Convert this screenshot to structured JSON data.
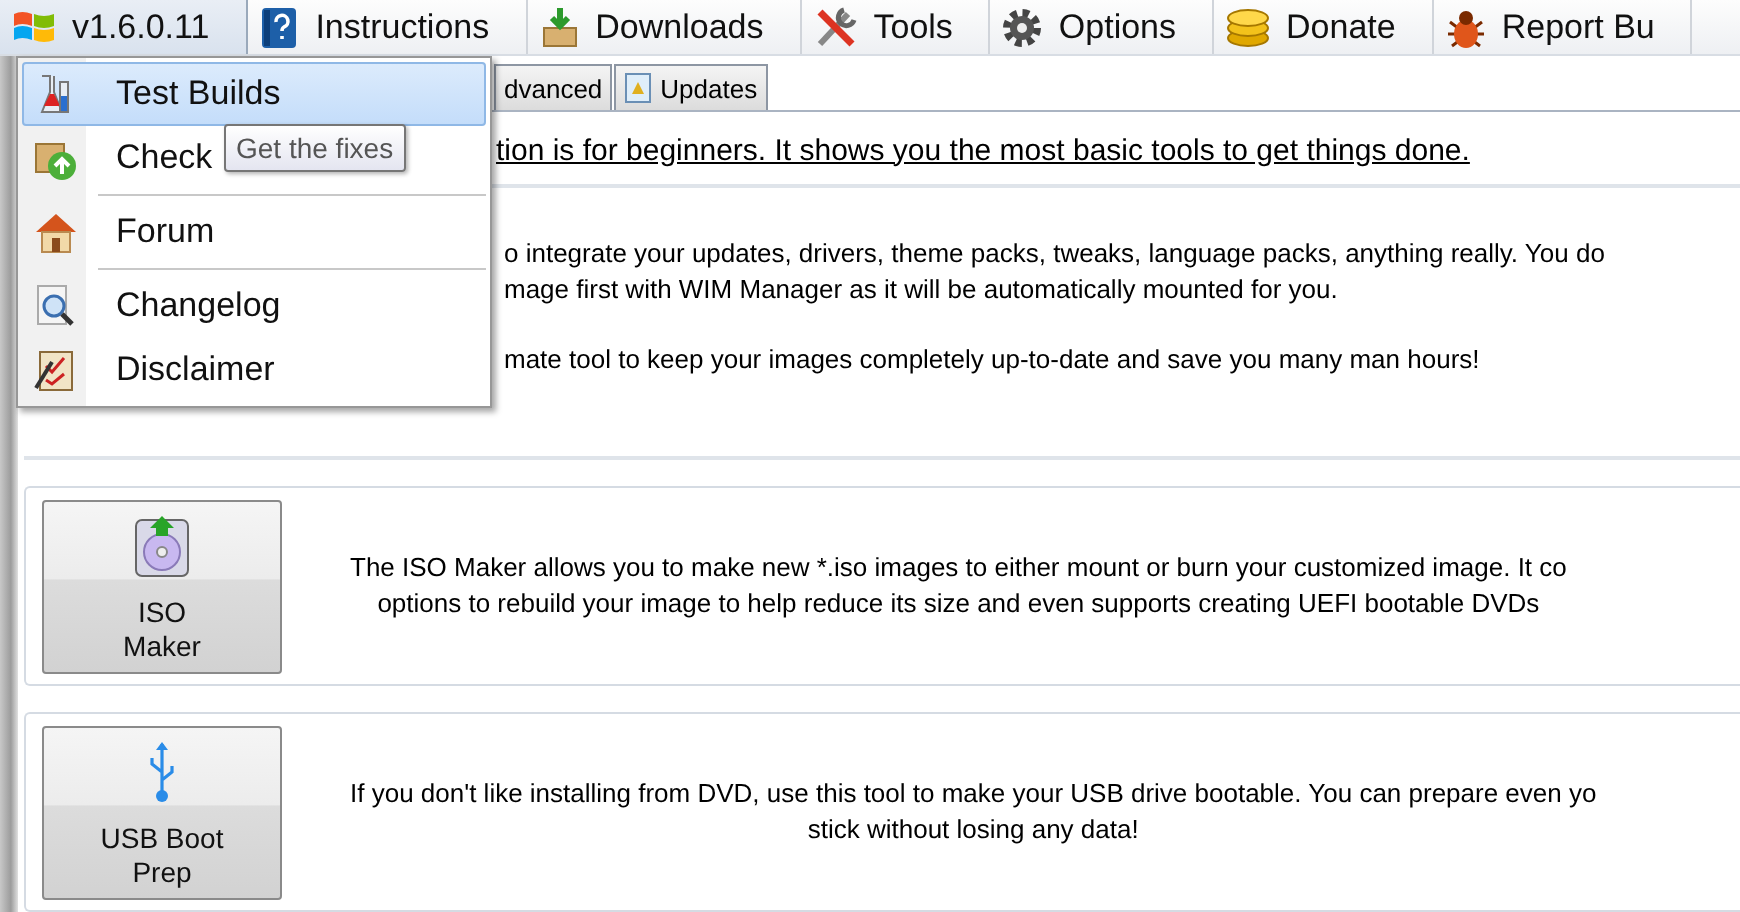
{
  "menubar": [
    {
      "label": "v1.6.0.11",
      "selected": true
    },
    {
      "label": "Instructions",
      "selected": false
    },
    {
      "label": "Downloads",
      "selected": false
    },
    {
      "label": "Tools",
      "selected": false
    },
    {
      "label": "Options",
      "selected": false
    },
    {
      "label": "Donate",
      "selected": false
    },
    {
      "label": "Report Bu",
      "selected": false
    }
  ],
  "tabs": [
    {
      "label": "dvanced",
      "selected": false
    },
    {
      "label": "Updates",
      "selected": false
    }
  ],
  "intro": {
    "text": "tion is for beginners. It shows you the most basic tools to get things done."
  },
  "wim_card": {
    "lines": [
      "o integrate your updates, drivers, theme packs, tweaks, language packs, anything really. You do",
      "mage first with WIM Manager as it will be automatically mounted for you.",
      "mate tool to keep your images completely up-to-date and save you many man hours!"
    ]
  },
  "tools": [
    {
      "kind": "disc",
      "label": [
        "ISO",
        "Maker"
      ],
      "description": [
        "The ISO Maker allows you to make new *.iso images to either mount or burn your customized image. It co",
        "options to rebuild your image to help reduce its size and even supports creating UEFI bootable DVDs"
      ]
    },
    {
      "kind": "usb",
      "label": [
        "USB Boot",
        "Prep"
      ],
      "description": [
        "If you don't like installing from DVD, use this tool to make your USB drive bootable. You can prepare even yo",
        "stick without losing any data!"
      ]
    }
  ],
  "dropdown": {
    "items": [
      {
        "kind": "item",
        "label": "Test Builds",
        "selected": true
      },
      {
        "kind": "item",
        "label": "Check",
        "selected": false
      },
      {
        "kind": "separator"
      },
      {
        "kind": "item",
        "label": "Forum",
        "selected": false
      },
      {
        "kind": "separator"
      },
      {
        "kind": "item",
        "label": "Changelog",
        "selected": false
      },
      {
        "kind": "item",
        "label": "Disclaimer",
        "selected": false
      }
    ]
  },
  "tooltip": {
    "text": "Get the fixes"
  }
}
